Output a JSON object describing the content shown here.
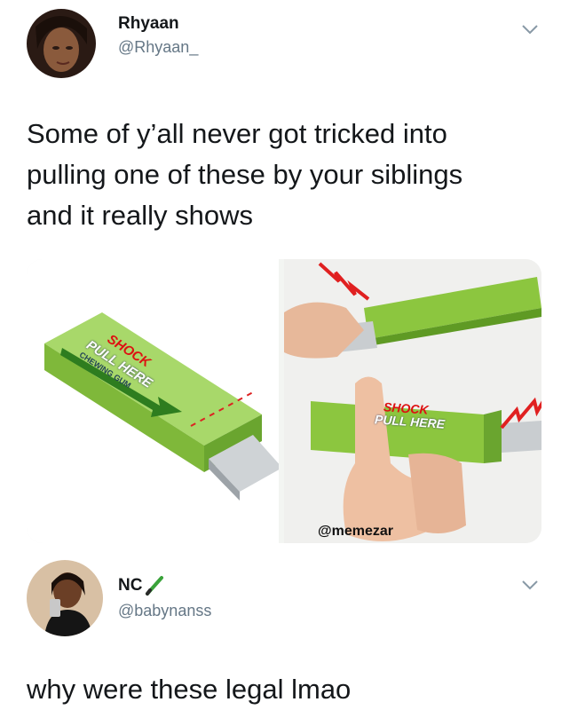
{
  "tweet1": {
    "display_name": "Rhyaan",
    "handle": "@Rhyaan_",
    "text_lines": [
      "Some of y’all never got tricked into",
      "pulling one of these by your siblings",
      "and it really shows"
    ],
    "media_watermark": "@memezar",
    "gum_brand": "SHOCK",
    "gum_label": "PULL HERE",
    "gum_sub": "CHEWING GUM"
  },
  "tweet2": {
    "display_name": "NC",
    "handle": "@babynanss",
    "text": "why were these legal lmao"
  },
  "icons": {
    "more": "chevron-down-icon",
    "badge": "pencil-icon"
  },
  "colors": {
    "gum_green": "#8cc63f",
    "shock_red": "#e02020",
    "handle_gray": "#657786"
  }
}
